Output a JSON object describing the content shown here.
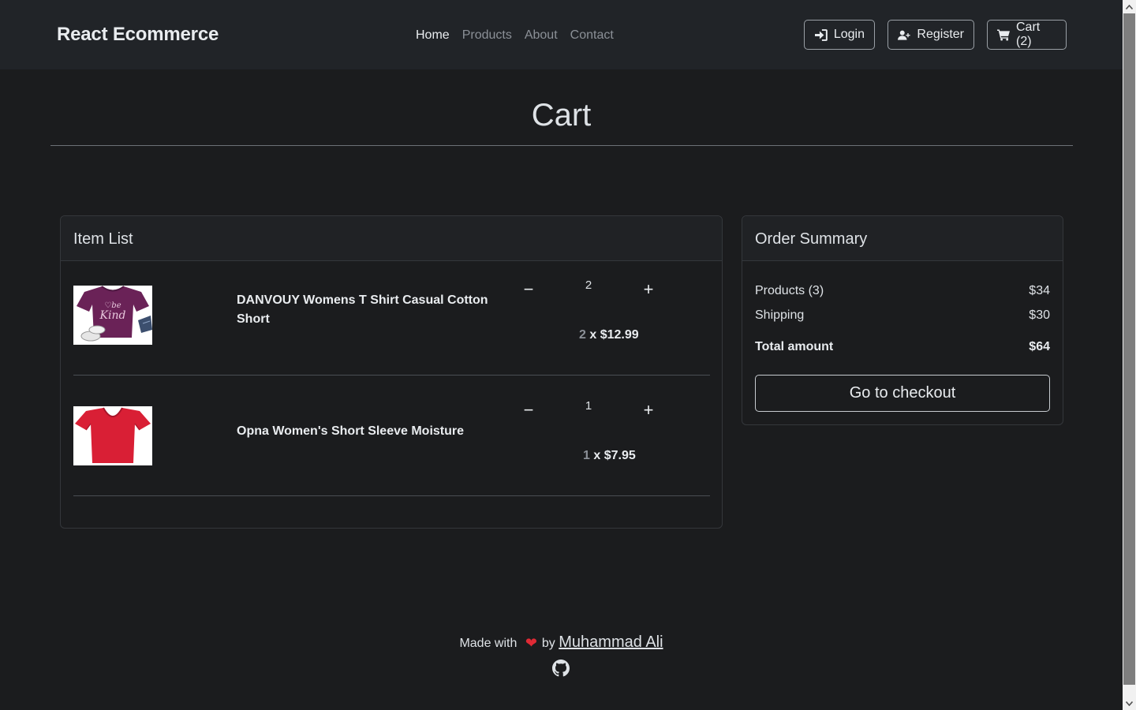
{
  "navbar": {
    "brand": "React Ecommerce",
    "links": [
      {
        "label": "Home",
        "active": true
      },
      {
        "label": "Products",
        "active": false
      },
      {
        "label": "About",
        "active": false
      },
      {
        "label": "Contact",
        "active": false
      }
    ],
    "buttons": {
      "login": {
        "label": "Login",
        "icon": "sign-in-icon"
      },
      "register": {
        "label": "Register",
        "icon": "user-plus-icon"
      },
      "cart": {
        "label": "Cart (2)",
        "icon": "shopping-cart-icon"
      }
    }
  },
  "page": {
    "title": "Cart"
  },
  "item_list": {
    "title": "Item List",
    "items": [
      {
        "name": "DANVOUY Womens T Shirt Casual Cotton Short",
        "quantity": "2",
        "price_qty": "2",
        "price_text": " x $12.99",
        "decrement": "−",
        "increment": "+"
      },
      {
        "name": "Opna Women's Short Sleeve Moisture",
        "quantity": "1",
        "price_qty": "1",
        "price_text": " x $7.95",
        "decrement": "−",
        "increment": "+"
      }
    ]
  },
  "summary": {
    "title": "Order Summary",
    "products_label": "Products (3)",
    "products_value": "$34",
    "shipping_label": "Shipping",
    "shipping_value": "$30",
    "total_label": "Total amount",
    "total_value": "$64",
    "checkout_label": "Go to checkout"
  },
  "footer": {
    "made_with": "Made with",
    "heart": "❤",
    "by": "by",
    "author": "Muhammad Ali",
    "github_icon": "github-icon"
  },
  "colors": {
    "background": "#1b1c1e",
    "navbar": "#212428",
    "heart": "#e02a35"
  }
}
